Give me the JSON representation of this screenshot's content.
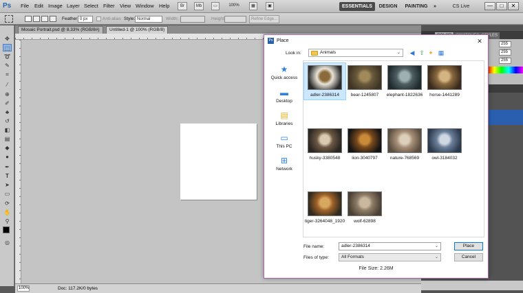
{
  "app": {
    "logo": "Ps",
    "menus": [
      "File",
      "Edit",
      "Image",
      "Layer",
      "Select",
      "Filter",
      "View",
      "Window",
      "Help"
    ],
    "zoom": "100%",
    "workspaces": [
      "ESSENTIALS",
      "DESIGN",
      "PAINTING",
      "»"
    ],
    "cs_live": "CS Live",
    "window_controls": [
      "—",
      "□",
      "✕"
    ]
  },
  "options": {
    "feather_label": "Feather:",
    "feather_value": "0 px",
    "antialias_label": "Anti-alias",
    "style_label": "Style:",
    "style_value": "Normal",
    "width_label": "Width:",
    "height_label": "Height:",
    "refine_edge": "Refine Edge..."
  },
  "doc_tabs": [
    "Mosaic Portrait.psd @ 8.33% (RGB/8#)",
    "Untitled-1 @ 100% (RGB/8)"
  ],
  "status": {
    "zoom": "100%",
    "doc": "Doc: 117.2K/0 bytes"
  },
  "panels": {
    "tabs": [
      "COLOR",
      "SWATCHES",
      "STYLES"
    ],
    "rgb": [
      "255",
      "255",
      "255"
    ]
  },
  "dialog": {
    "title": "Place",
    "look_in_label": "Look in:",
    "look_in_value": "Animals",
    "places": [
      "Quick access",
      "Desktop",
      "Libraries",
      "This PC",
      "Network"
    ],
    "files": [
      {
        "name": "adler-2386314",
        "selected": true,
        "colors": [
          "#2a2a2a",
          "#e9e4d8",
          "#8a6a3a"
        ]
      },
      {
        "name": "bear-1245807",
        "selected": false,
        "colors": [
          "#3d3424",
          "#6b5a3c",
          "#a08a5c"
        ]
      },
      {
        "name": "elephant-1822636",
        "selected": false,
        "colors": [
          "#1f2a2e",
          "#4f5f63",
          "#9fb0b2"
        ]
      },
      {
        "name": "horse-1441289",
        "selected": false,
        "colors": [
          "#3a2a1e",
          "#8a6a3e",
          "#d4b483"
        ]
      },
      {
        "name": "husky-3380548",
        "selected": false,
        "colors": [
          "#2a2622",
          "#6d5a44",
          "#d8c9b0"
        ]
      },
      {
        "name": "lion-3040797",
        "selected": false,
        "colors": [
          "#141414",
          "#7a4a1c",
          "#c98a3a"
        ]
      },
      {
        "name": "nature-768569",
        "selected": false,
        "colors": [
          "#5a4e40",
          "#a89078",
          "#dccfbb"
        ]
      },
      {
        "name": "owl-3184032",
        "selected": false,
        "colors": [
          "#2c3a4c",
          "#6b7f99",
          "#cfd8e2"
        ]
      },
      {
        "name": "tiger-3264048_1920",
        "selected": false,
        "colors": [
          "#2e2a1e",
          "#a0622a",
          "#d9a860"
        ]
      },
      {
        "name": "wolf-62898",
        "selected": false,
        "colors": [
          "#4a3f34",
          "#8d7c66",
          "#c9b89e"
        ]
      }
    ],
    "file_name_label": "File name:",
    "file_name_value": "adler-2386314",
    "file_type_label": "Files of type:",
    "file_type_value": "All Formats",
    "place_button": "Place",
    "cancel_button": "Cancel",
    "file_size": "File Size: 2.26M"
  }
}
